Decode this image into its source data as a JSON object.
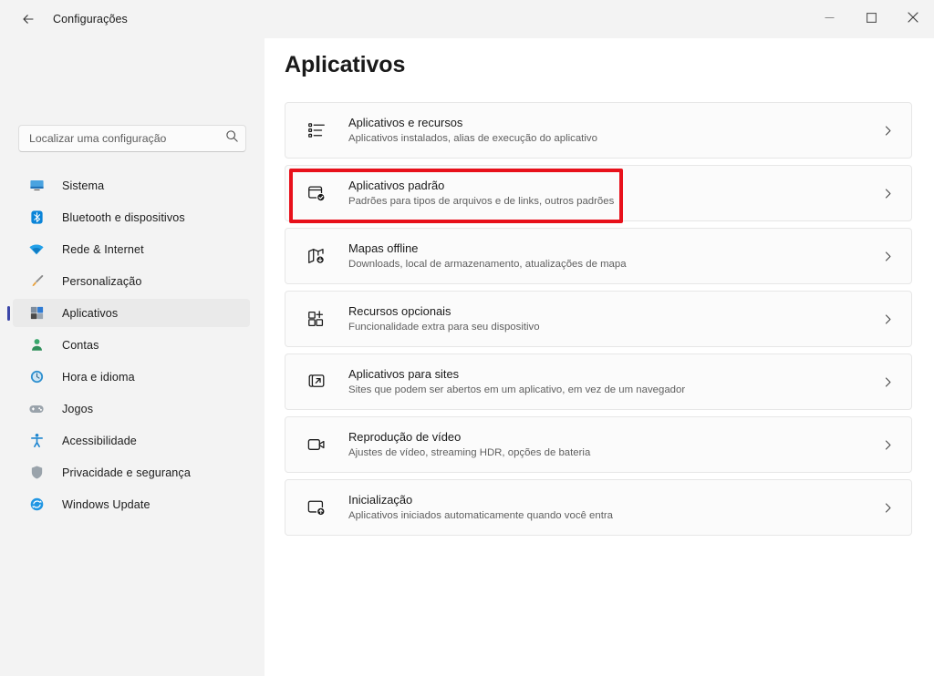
{
  "window": {
    "title": "Configurações",
    "back_icon": "arrow-left-icon",
    "controls": {
      "minimize": "—",
      "maximize": "□",
      "close": "✕"
    }
  },
  "search": {
    "placeholder": "Localizar uma configuração",
    "value": "",
    "icon": "search-icon"
  },
  "sidebar": {
    "items": [
      {
        "label": "Sistema",
        "icon": "monitor-icon",
        "selected": false
      },
      {
        "label": "Bluetooth e dispositivos",
        "icon": "bluetooth-icon",
        "selected": false
      },
      {
        "label": "Rede & Internet",
        "icon": "wifi-icon",
        "selected": false
      },
      {
        "label": "Personalização",
        "icon": "paintbrush-icon",
        "selected": false
      },
      {
        "label": "Aplicativos",
        "icon": "apps-icon",
        "selected": true
      },
      {
        "label": "Contas",
        "icon": "person-icon",
        "selected": false
      },
      {
        "label": "Hora e idioma",
        "icon": "clock-icon",
        "selected": false
      },
      {
        "label": "Jogos",
        "icon": "gamepad-icon",
        "selected": false
      },
      {
        "label": "Acessibilidade",
        "icon": "accessibility-icon",
        "selected": false
      },
      {
        "label": "Privacidade e segurança",
        "icon": "shield-icon",
        "selected": false
      },
      {
        "label": "Windows Update",
        "icon": "update-icon",
        "selected": false
      }
    ]
  },
  "main": {
    "title": "Aplicativos",
    "cards": [
      {
        "title": "Aplicativos e recursos",
        "subtitle": "Aplicativos instalados, alias de execução do aplicativo",
        "icon": "app-list-icon",
        "chevron": "chevron-right-icon",
        "highlighted": false
      },
      {
        "title": "Aplicativos padrão",
        "subtitle": "Padrões para tipos de arquivos e de links, outros padrões",
        "icon": "default-apps-check-icon",
        "chevron": "chevron-right-icon",
        "highlighted": true
      },
      {
        "title": "Mapas offline",
        "subtitle": "Downloads, local de armazenamento, atualizações de mapa",
        "icon": "map-download-icon",
        "chevron": "chevron-right-icon",
        "highlighted": false
      },
      {
        "title": "Recursos opcionais",
        "subtitle": "Funcionalidade extra para seu dispositivo",
        "icon": "optional-features-plus-icon",
        "chevron": "chevron-right-icon",
        "highlighted": false
      },
      {
        "title": "Aplicativos para sites",
        "subtitle": "Sites que podem ser abertos em um aplicativo, em vez de um navegador",
        "icon": "open-external-icon",
        "chevron": "chevron-right-icon",
        "highlighted": false
      },
      {
        "title": "Reprodução de vídeo",
        "subtitle": "Ajustes de vídeo, streaming HDR, opções de bateria",
        "icon": "video-icon",
        "chevron": "chevron-right-icon",
        "highlighted": false
      },
      {
        "title": "Inicialização",
        "subtitle": "Aplicativos iniciados automaticamente quando você entra",
        "icon": "startup-apps-icon",
        "chevron": "chevron-right-icon",
        "highlighted": false
      }
    ]
  },
  "annotation": {
    "highlight_color": "#e8111b",
    "target": "Aplicativos padrão"
  }
}
